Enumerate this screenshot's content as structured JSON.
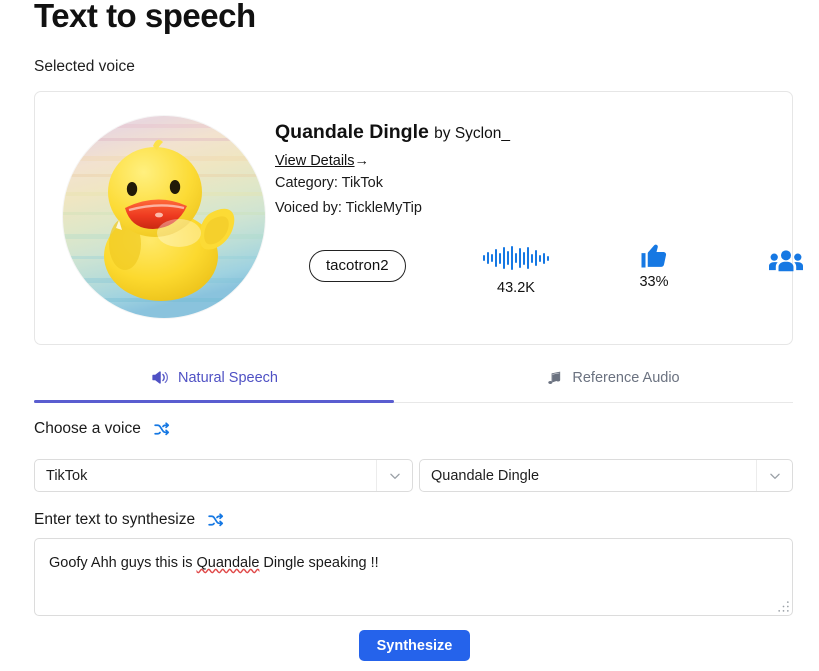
{
  "header": {
    "title": "Text to speech",
    "selected_voice_label": "Selected voice"
  },
  "voice_card": {
    "avatar_alt": "rubber-duck-avatar",
    "name": "Quandale Dingle",
    "by": "by Syclon_",
    "view_details": "View Details",
    "view_details_arrow": "→",
    "category": "Category: TikTok",
    "voiced_by": "Voiced by: TickleMyTip",
    "model_badge": "tacotron2",
    "stats": {
      "plays_icon": "waveform-icon",
      "plays_value": "43.2K",
      "likes_icon": "thumbs-up-icon",
      "likes_value": "33%",
      "users_icon": "people-icon",
      "users_value": ""
    }
  },
  "tabs": [
    {
      "label": "Natural Speech",
      "icon": "megaphone-icon",
      "active": true
    },
    {
      "label": "Reference Audio",
      "icon": "music-note-icon",
      "active": false
    }
  ],
  "form": {
    "choose_voice_label": "Choose a voice",
    "shuffle_icon": "shuffle-icon",
    "category_select": "TikTok",
    "voice_select": "Quandale Dingle",
    "enter_text_label": "Enter text to synthesize",
    "text_value_pre": "Goofy Ahh guys this is ",
    "text_value_misspelled": "Quandale",
    "text_value_post": " Dingle speaking !!",
    "synthesize_label": "Synthesize"
  },
  "colors": {
    "accent_blue": "#2563eb",
    "tab_active": "#5a5dd0",
    "icon_blue": "#1678e3",
    "spellcheck_red": "#e04a4a",
    "border": "#dcdcdc"
  }
}
